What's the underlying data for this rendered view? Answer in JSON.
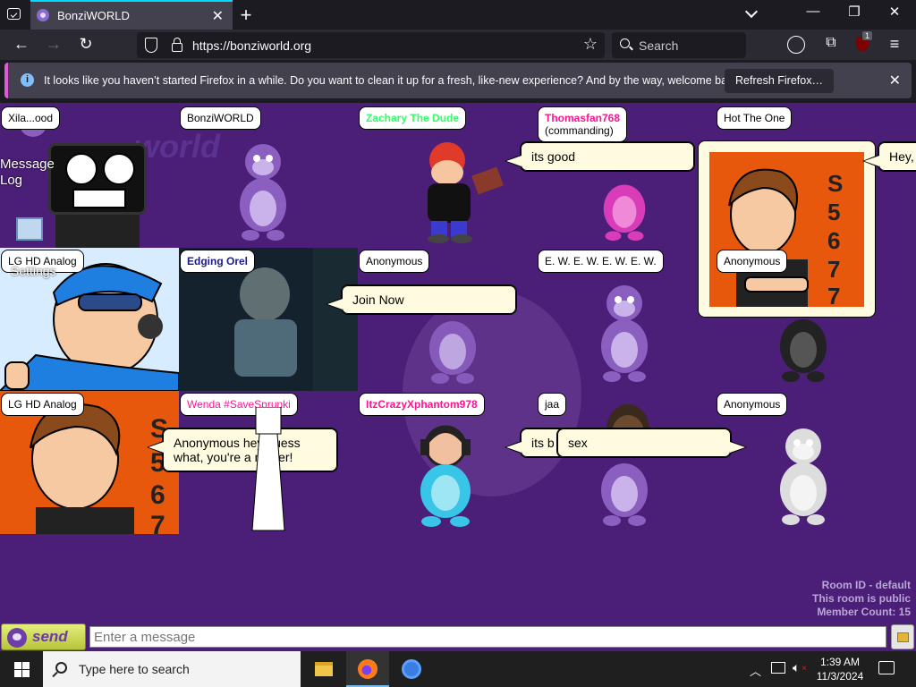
{
  "browser": {
    "tab_title": "BonziWORLD",
    "url": "https://bonziworld.org",
    "search_placeholder": "Search",
    "notification": {
      "text": "It looks like you haven’t started Firefox in a while. Do you want to clean it up for a fresh, like-new experience? And by the way, welcome back!",
      "button_label": "Refresh Firefox…"
    },
    "extension_badge": "1"
  },
  "sidebar": {
    "message_log_label": "Message Log",
    "settings_label": "Settings"
  },
  "users": [
    {
      "name": "Xila...ood",
      "color": "#000000"
    },
    {
      "name": "BonziWORLD",
      "color": "#000000"
    },
    {
      "name": "Zachary The Dude",
      "color": "#33ff66"
    },
    {
      "name": "Thomasfan768",
      "subtitle": "(commanding)",
      "color": "#ff1493"
    },
    {
      "name": "Hot The One",
      "color": "#000000"
    },
    {
      "name": "LG HD Analog",
      "color": "#000000"
    },
    {
      "name": "Edging Orel",
      "color": "#1a1a8c"
    },
    {
      "name": "Anonymous",
      "color": "#000000"
    },
    {
      "name": "E. W. E. W. E. W. E. W.",
      "color": "#000000"
    },
    {
      "name": "Anonymous",
      "color": "#000000"
    },
    {
      "name": "LG HD Analog",
      "color": "#000000"
    },
    {
      "name": "Wenda #SaveSprunki",
      "color": "#ff1493"
    },
    {
      "name": "ItzCrazyXphantom978",
      "color": "#ff1493"
    },
    {
      "name": "jaa",
      "color": "#000000"
    },
    {
      "name": "Anonymous",
      "color": "#000000"
    }
  ],
  "bubbles": {
    "its_good": "its good",
    "hey": "Hey,",
    "join_now": "Join Now",
    "anon_message": "Anonymous hey guess what, you're a nigger!",
    "its_b": "its b",
    "sex": "sex"
  },
  "room": {
    "id_line": "Room ID - default",
    "public_line": "This room is public",
    "count_line": "Member Count: 15"
  },
  "chat": {
    "send_label": "send",
    "input_placeholder": "Enter a message"
  },
  "taskbar": {
    "search_placeholder": "Type here to search",
    "time": "1:39 AM",
    "date": "11/3/2024"
  },
  "colors": {
    "room_bg": "#4b1e78",
    "bubble_bg": "#fffbe0",
    "bonzi_purple": "#8a5fc0",
    "bonzi_pink": "#d93cb8",
    "bonzi_black": "#222222",
    "bonzi_white": "#dddddd",
    "bonzi_cyan": "#39c5e8"
  }
}
